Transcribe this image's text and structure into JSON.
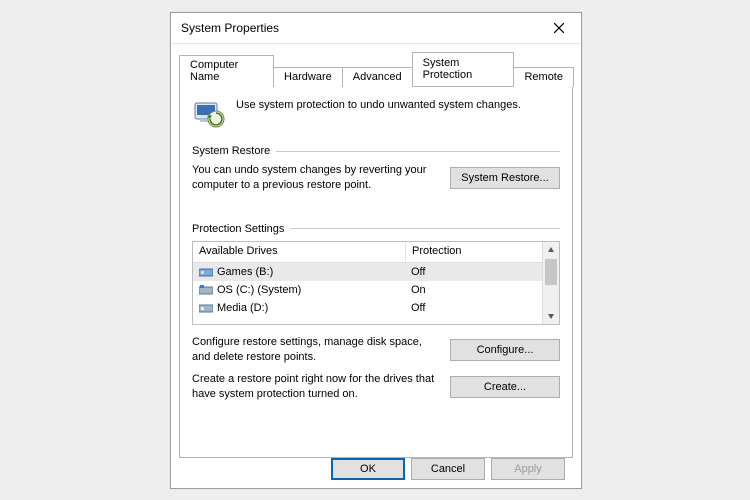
{
  "window": {
    "title": "System Properties"
  },
  "tabs": [
    {
      "label": "Computer Name"
    },
    {
      "label": "Hardware"
    },
    {
      "label": "Advanced"
    },
    {
      "label": "System Protection"
    },
    {
      "label": "Remote"
    }
  ],
  "intro": "Use system protection to undo unwanted system changes.",
  "restore": {
    "group": "System Restore",
    "desc": "You can undo system changes by reverting your computer to a previous restore point.",
    "button": "System Restore..."
  },
  "protection": {
    "group": "Protection Settings",
    "hdr_drives": "Available Drives",
    "hdr_prot": "Protection",
    "drives": [
      {
        "name": "Games (B:)",
        "prot": "Off"
      },
      {
        "name": "OS (C:) (System)",
        "prot": "On"
      },
      {
        "name": "Media (D:)",
        "prot": "Off"
      }
    ],
    "configure_desc": "Configure restore settings, manage disk space, and delete restore points.",
    "configure_button": "Configure...",
    "create_desc": "Create a restore point right now for the drives that have system protection turned on.",
    "create_button": "Create..."
  },
  "footer": {
    "ok": "OK",
    "cancel": "Cancel",
    "apply": "Apply"
  }
}
